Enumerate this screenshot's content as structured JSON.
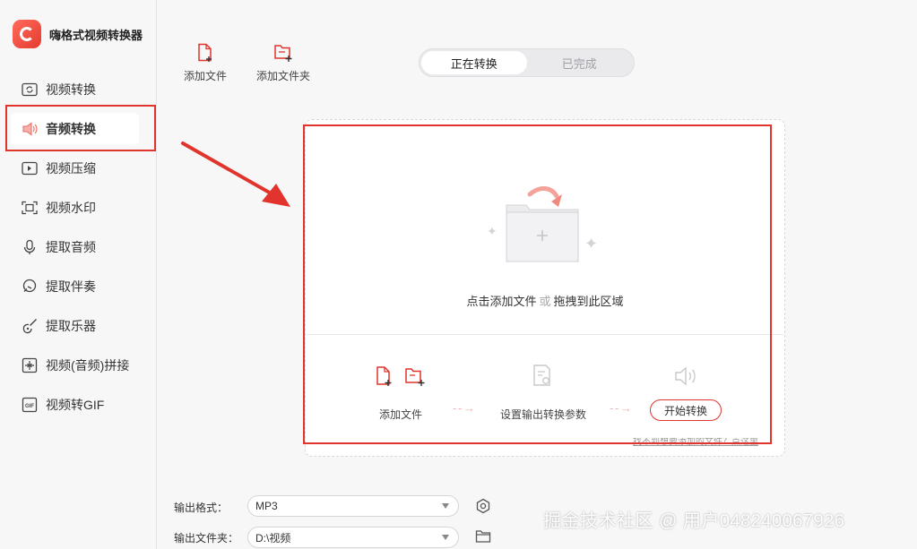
{
  "app": {
    "title": "嗨格式视频转换器"
  },
  "sidebar": {
    "items": [
      {
        "label": "视频转换",
        "icon": "video-convert-icon"
      },
      {
        "label": "音频转换",
        "icon": "audio-icon",
        "active": true
      },
      {
        "label": "视频压缩",
        "icon": "video-compress-icon"
      },
      {
        "label": "视频水印",
        "icon": "watermark-icon"
      },
      {
        "label": "提取音频",
        "icon": "mic-icon"
      },
      {
        "label": "提取伴奏",
        "icon": "headset-icon"
      },
      {
        "label": "提取乐器",
        "icon": "guitar-icon"
      },
      {
        "label": "视频(音频)拼接",
        "icon": "merge-icon"
      },
      {
        "label": "视频转GIF",
        "icon": "gif-icon"
      }
    ]
  },
  "toolbar": {
    "add_file": "添加文件",
    "add_folder": "添加文件夹"
  },
  "tabs": {
    "converting": "正在转换",
    "done": "已完成"
  },
  "dropzone": {
    "text_click": "点击添加文件",
    "text_or": "或",
    "text_drag": "拖拽到此区域",
    "step1": "添加文件",
    "step2": "设置输出转换参数",
    "start_button": "开始转换",
    "hint": "找不到想要添加的文件？点这里"
  },
  "output": {
    "format_label": "输出格式：",
    "format_value": "MP3",
    "folder_label": "输出文件夹：",
    "folder_value": "D:\\视频"
  },
  "watermark": "掘金技术社区 @ 用户048240067926",
  "colors": {
    "accent": "#e0342c",
    "accent_light": "#f3b3ae"
  }
}
